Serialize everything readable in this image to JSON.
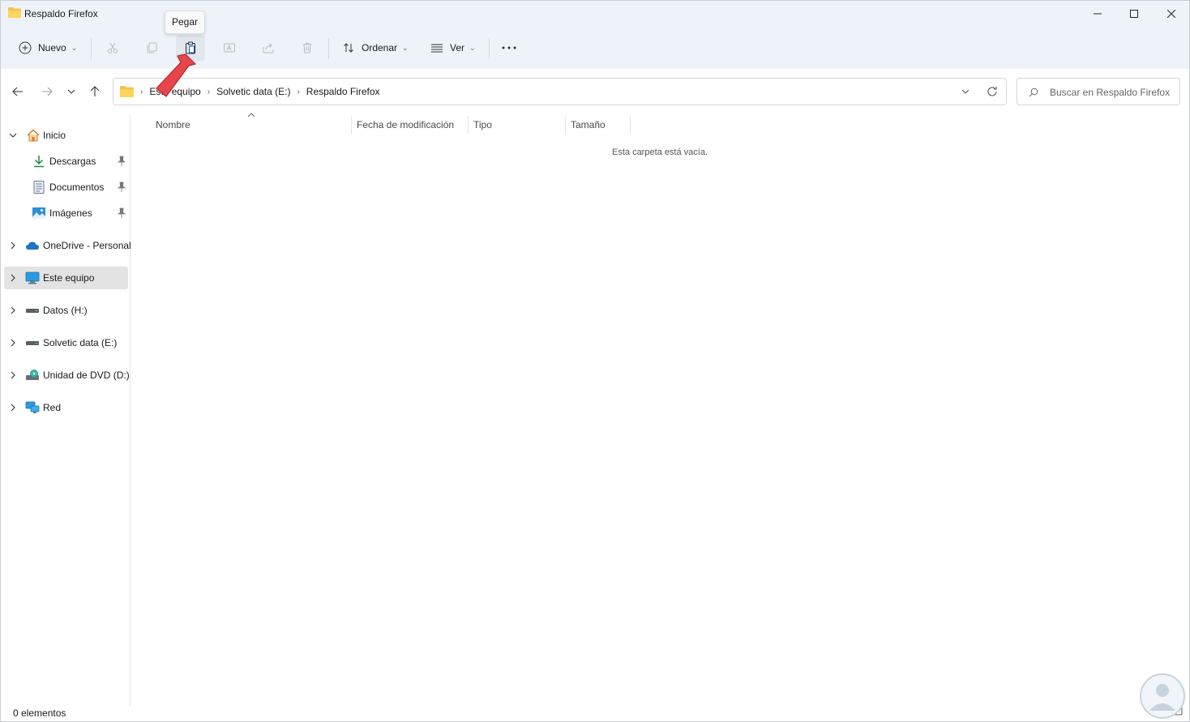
{
  "window": {
    "title": "Respaldo Firefox"
  },
  "toolbar": {
    "new_label": "Nuevo",
    "sort_label": "Ordenar",
    "view_label": "Ver",
    "tooltip": "Pegar"
  },
  "address": {
    "crumbs": [
      "Este equipo",
      "Solvetic data (E:)",
      "Respaldo Firefox"
    ],
    "search_placeholder": "Buscar en Respaldo Firefox"
  },
  "sidebar": {
    "items": [
      {
        "label": "Inicio"
      },
      {
        "label": "Descargas"
      },
      {
        "label": "Documentos"
      },
      {
        "label": "Imágenes"
      },
      {
        "label": "OneDrive - Personal"
      },
      {
        "label": "Este equipo"
      },
      {
        "label": "Datos (H:)"
      },
      {
        "label": "Solvetic data (E:)"
      },
      {
        "label": "Unidad de DVD (D:)"
      },
      {
        "label": "Red"
      }
    ]
  },
  "content": {
    "columns": [
      "Nombre",
      "Fecha de modificación",
      "Tipo",
      "Tamaño"
    ],
    "empty_message": "Esta carpeta está vacía."
  },
  "status": {
    "count": "0 elementos"
  },
  "colors": {
    "accent": "#0067c0",
    "pointer_arrow": "#e8454a",
    "toolbar_bg": "#eef3fa"
  }
}
